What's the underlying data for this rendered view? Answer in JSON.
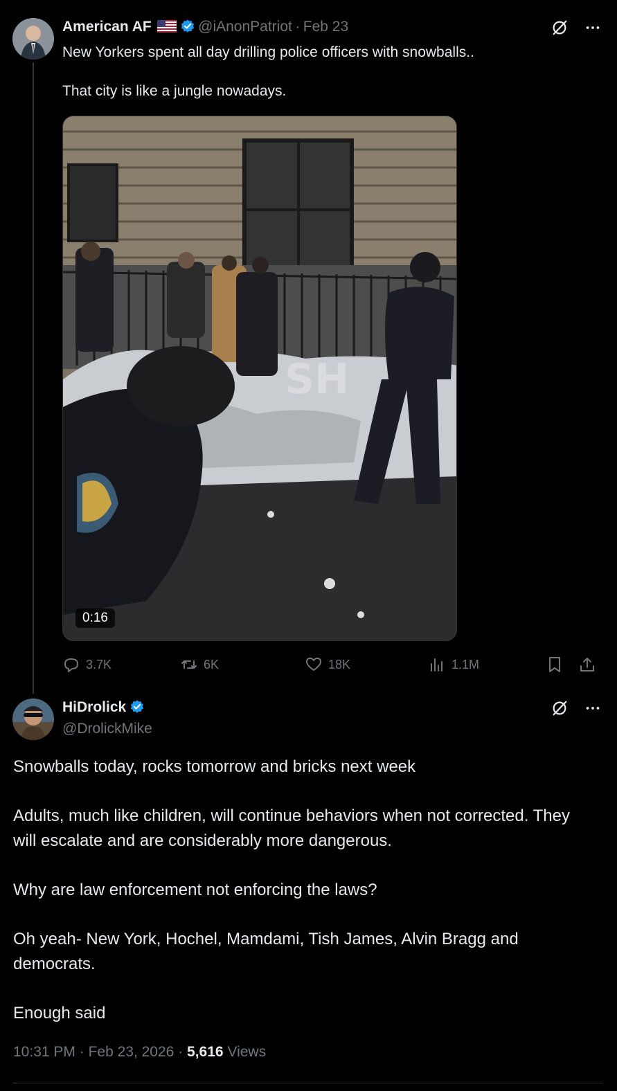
{
  "tweet": {
    "author_name": "American AF",
    "flag_icon": "us-flag-icon",
    "handle": "@iAnonPatriot",
    "sep": "·",
    "date": "Feb 23",
    "text": "New Yorkers spent all day drilling police officers with snowballs..\n\nThat city is like a jungle nowadays.",
    "media": {
      "duration": "0:16",
      "watermark": "SH"
    },
    "actions": {
      "replies": "3.7K",
      "reposts": "6K",
      "likes": "18K",
      "views": "1.1M"
    }
  },
  "reply": {
    "author_name": "HiDrolick",
    "handle": "@DrolickMike",
    "paragraphs": [
      "Snowballs today, rocks tomorrow and bricks next week",
      "Adults, much like children, will continue behaviors when not corrected. They will escalate and are considerably more dangerous.",
      "Why are law enforcement not enforcing the laws?",
      "Oh yeah- New York, Hochel, Mamdami, Tish James, Alvin Bragg and democrats.",
      "Enough said"
    ],
    "meta": {
      "time": "10:31 PM",
      "sep1": "·",
      "date": "Feb 23, 2026",
      "sep2": "·",
      "views_count": "5,616",
      "views_label": "Views"
    }
  },
  "colors": {
    "background": "#000000",
    "text": "#e7e9ea",
    "muted": "#71767b",
    "verified": "#1d9bf0"
  }
}
